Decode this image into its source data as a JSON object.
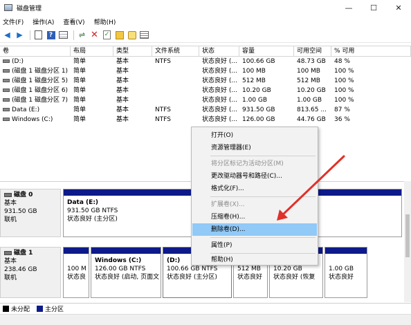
{
  "window": {
    "title": "磁盘管理",
    "minimize": "—",
    "maximize": "☐",
    "close": "✕"
  },
  "menu": [
    "文件(F)",
    "操作(A)",
    "查看(V)",
    "帮助(H)"
  ],
  "toolbar": {
    "icons": [
      "back-icon",
      "forward-icon",
      "properties-icon",
      "help-icon",
      "list-icon",
      "connect-icon",
      "delete-icon",
      "check-icon",
      "folder-icon",
      "settings-icon",
      "view-icon"
    ]
  },
  "table": {
    "headers": [
      "卷",
      "布局",
      "类型",
      "文件系统",
      "状态",
      "容量",
      "可用空间",
      "% 可用"
    ],
    "rows": [
      [
        "(D:)",
        "简单",
        "基本",
        "NTFS",
        "状态良好 (...",
        "100.66 GB",
        "48.73 GB",
        "48 %"
      ],
      [
        "(磁盘 1 磁盘分区 1)",
        "简单",
        "基本",
        "",
        "状态良好 (...",
        "100 MB",
        "100 MB",
        "100 %"
      ],
      [
        "(磁盘 1 磁盘分区 5)",
        "简单",
        "基本",
        "",
        "状态良好 (...",
        "512 MB",
        "512 MB",
        "100 %"
      ],
      [
        "(磁盘 1 磁盘分区 6)",
        "简单",
        "基本",
        "",
        "状态良好 (...",
        "10.20 GB",
        "10.20 GB",
        "100 %"
      ],
      [
        "(磁盘 1 磁盘分区 7)",
        "简单",
        "基本",
        "",
        "状态良好 (...",
        "1.00 GB",
        "1.00 GB",
        "100 %"
      ],
      [
        "Data (E:)",
        "简单",
        "基本",
        "NTFS",
        "状态良好 (...",
        "931.50 GB",
        "813.65 ...",
        "87 %"
      ],
      [
        "Windows (C:)",
        "简单",
        "基本",
        "NTFS",
        "状态良好 (...",
        "126.00 GB",
        "44.76 GB",
        "36 %"
      ]
    ]
  },
  "disks": {
    "disk0": {
      "name": "磁盘 0",
      "type": "基本",
      "size": "931.50 GB",
      "status": "联机",
      "partitions": [
        {
          "name": "Data  (E:)",
          "detail": "931.50 GB NTFS",
          "status": "状态良好 (主分区)"
        }
      ]
    },
    "disk1": {
      "name": "磁盘 1",
      "type": "基本",
      "size": "238.46 GB",
      "status": "联机",
      "partitions": [
        {
          "name": "",
          "detail": "100 M",
          "status": "状态良"
        },
        {
          "name": "Windows  (C:)",
          "detail": "126.00 GB NTFS",
          "status": "状态良好 (启动, 页面文"
        },
        {
          "name": "(D:)",
          "detail": "100.66 GB NTFS",
          "status": "状态良好 (主分区)"
        },
        {
          "name": "",
          "detail": "512 MB",
          "status": "状态良好"
        },
        {
          "name": "",
          "detail": "10.20 GB",
          "status": "状态良好 (恢复"
        },
        {
          "name": "",
          "detail": "1.00 GB",
          "status": "状态良好"
        }
      ]
    }
  },
  "legend": [
    {
      "label": "未分配",
      "color": "#000000"
    },
    {
      "label": "主分区",
      "color": "#0d1a8a"
    }
  ],
  "context_menu": {
    "open": "打开(O)",
    "explorer": "资源管理器(E)",
    "mark_active": "将分区标记为活动分区(M)",
    "change_letter": "更改驱动器号和路径(C)...",
    "format": "格式化(F)...",
    "extend": "扩展卷(X)...",
    "shrink": "压缩卷(H)...",
    "delete": "删除卷(D)...",
    "properties": "属性(P)",
    "help": "帮助(H)"
  },
  "colors": {
    "primary_partition": "#0d1a8a",
    "highlight": "#91c9f7",
    "arrow": "#e0302a"
  }
}
